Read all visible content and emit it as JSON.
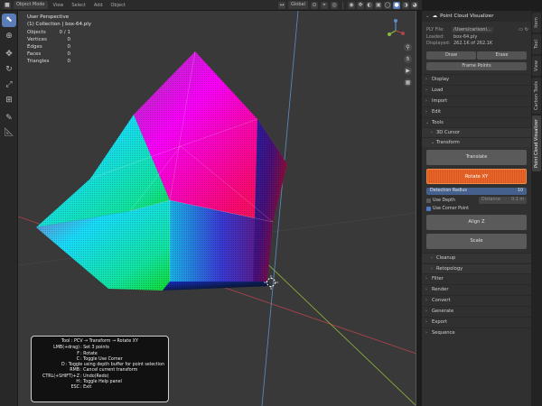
{
  "header": {
    "editor_icon": "cube-icon",
    "mode": "Object Mode",
    "menus": [
      "View",
      "Select",
      "Add",
      "Object"
    ],
    "transform_orientation": "Global"
  },
  "toolbar": {
    "tools": [
      "select-box-icon",
      "cursor-icon",
      "move-icon",
      "rotate-icon",
      "scale-icon",
      "transform-icon",
      "annotate-icon",
      "measure-icon"
    ]
  },
  "viewport": {
    "perspective": "User Perspective",
    "collection": "(1) Collection | box-64.ply",
    "stats": [
      {
        "label": "Objects",
        "value": "0 / 1"
      },
      {
        "label": "Vertices",
        "value": "0"
      },
      {
        "label": "Edges",
        "value": "0"
      },
      {
        "label": "Faces",
        "value": "0"
      },
      {
        "label": "Triangles",
        "value": "0"
      }
    ]
  },
  "help": {
    "title": "Tool : PCV → Transform → Rotate XY",
    "lines": [
      {
        "key": "LMB(+drag)",
        "desc": ": Set 3 points"
      },
      {
        "key": "F",
        "desc": ": Rotate"
      },
      {
        "key": "C",
        "desc": ": Toggle Use Corner"
      },
      {
        "key": "D",
        "desc": ": Toggle using depth buffer for point selection"
      },
      {
        "key": "RMB",
        "desc": ": Cancel current transform"
      },
      {
        "key": "CTRL(+SHIFT)+Z",
        "desc": ": Undo(Redo)"
      },
      {
        "key": "H",
        "desc": ": Toggle Help panel"
      },
      {
        "key": "ESC",
        "desc": ": Exit"
      }
    ]
  },
  "panel": {
    "title": "Point Cloud Visualizer",
    "ply_label": "PLY File:",
    "ply_value": "/Users/carlsonl...",
    "loaded_label": "Loaded:",
    "loaded_value": "box-64.ply",
    "displayed_label": "Displayed:",
    "displayed_value": "262.1K of 262.1K",
    "draw_label": "Draw",
    "erase_label": "Erase",
    "frame_points_label": "Frame Points",
    "sections": [
      "Display",
      "Load",
      "Import",
      "Edit",
      "Tools"
    ],
    "tools_sub": [
      "3D Cursor",
      "Transform"
    ],
    "translate_label": "Translate",
    "rotate_label": "Rotate XY",
    "detection_label": "Detection Radius",
    "detection_value": "10",
    "use_depth_label": "Use Depth",
    "use_depth": false,
    "distance_label": "Distance",
    "distance_value": "0.1 m",
    "use_corner_label": "Use Corner Point",
    "use_corner": true,
    "alignz_label": "Align Z",
    "scale_label": "Scale",
    "sub_after": [
      "Cleanup",
      "Retopology"
    ],
    "sections_after": [
      "Filter",
      "Render",
      "Convert",
      "Generate",
      "Export",
      "Sequence"
    ]
  },
  "vtabs": [
    "Item",
    "Tool",
    "View",
    "Carbon Tools",
    "Point Cloud Visualizer"
  ],
  "colors": {
    "accent": "#5a7cb8",
    "rotate_active": "#e3612a",
    "x_axis": "#b0434b",
    "y_axis": "#8fb63c",
    "z_axis": "#5d8fc6"
  }
}
